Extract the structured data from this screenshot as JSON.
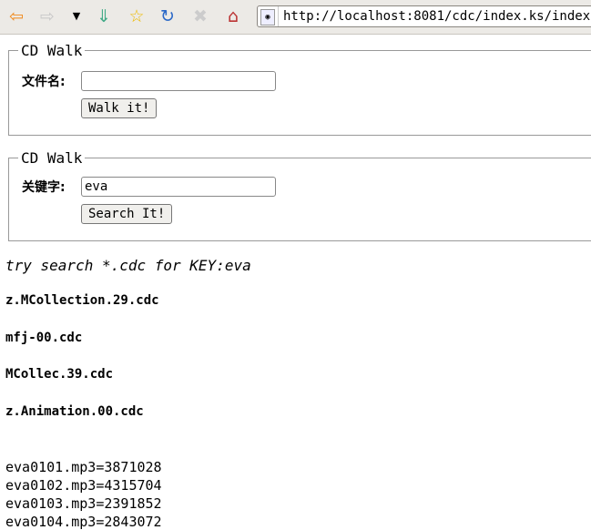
{
  "browser": {
    "url": "http://localhost:8081/cdc/index.ks/index",
    "icons": [
      "back-icon",
      "forward-icon",
      "dropdown-icon",
      "download-icon",
      "bookmark-icon",
      "reload-icon",
      "stop-icon",
      "home-icon"
    ]
  },
  "walk_form": {
    "legend": "CD Walk",
    "label": "文件名:",
    "value": "",
    "button": "Walk it!"
  },
  "search_form": {
    "legend": "CD Walk",
    "label": "关键字:",
    "value": "eva",
    "button": "Search It!"
  },
  "results": {
    "heading": "try search *.cdc for KEY:eva",
    "files": [
      "z.MCollection.29.cdc",
      "mfj-00.cdc",
      "MCollec.39.cdc",
      "z.Animation.00.cdc"
    ],
    "matches": [
      "eva0101.mp3=3871028",
      "eva0102.mp3=4315704",
      "eva0103.mp3=2391852",
      "eva0104.mp3=2843072"
    ]
  }
}
